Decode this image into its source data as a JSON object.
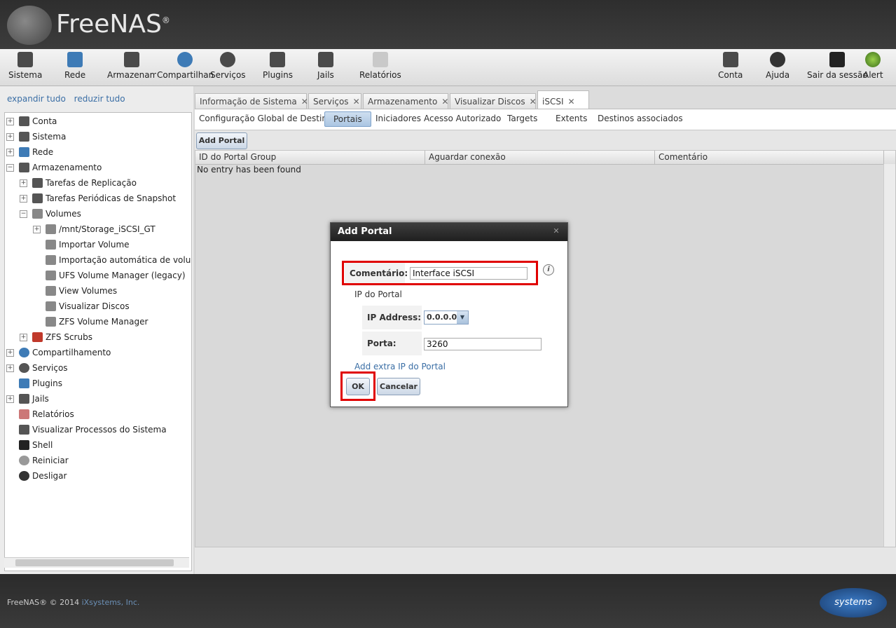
{
  "app": {
    "brand": "FreeNAS",
    "registered": "®"
  },
  "toolbar": {
    "sistema": "Sistema",
    "rede": "Rede",
    "armazenamento": "Armazenamento",
    "compartilhamento": "Compartilhamento",
    "servicos": "Serviços",
    "plugins": "Plugins",
    "jails": "Jails",
    "relatorios": "Relatórios",
    "conta": "Conta",
    "ajuda": "Ajuda",
    "sair": "Sair da sessão",
    "alert": "Alert"
  },
  "sidebar": {
    "expand_all": "expandir tudo",
    "collapse_all": "reduzir tudo",
    "tree": {
      "conta": "Conta",
      "sistema": "Sistema",
      "rede": "Rede",
      "armazenamento": "Armazenamento",
      "replicacao": "Tarefas de Replicação",
      "snapshot": "Tarefas Periódicas de Snapshot",
      "volumes": "Volumes",
      "mnt": "/mnt/Storage_iSCSI_GT",
      "importar": "Importar Volume",
      "auto_import": "Importação automática de volume",
      "ufs": "UFS Volume Manager (legacy)",
      "view_volumes": "View Volumes",
      "visualizar_discos": "Visualizar Discos",
      "zfs_manager": "ZFS Volume Manager",
      "zfs_scrubs": "ZFS Scrubs",
      "compartilhamento": "Compartilhamento",
      "servicos": "Serviços",
      "plugins": "Plugins",
      "jails": "Jails",
      "relatorios": "Relatórios",
      "processos": "Visualizar Processos do Sistema",
      "shell": "Shell",
      "reiniciar": "Reiniciar",
      "desligar": "Desligar"
    }
  },
  "tabs": {
    "info": "Informação de Sistema",
    "servicos": "Serviços",
    "armazenamento": "Armazenamento",
    "discos": "Visualizar Discos",
    "iscsi": "iSCSI",
    "close": "✕"
  },
  "subtabs": {
    "global": "Configuração Global de Destino",
    "portais": "Portais",
    "iniciadores": "Iniciadores",
    "acesso": "Acesso Autorizado",
    "targets": "Targets",
    "extents": "Extents",
    "destinos": "Destinos associados"
  },
  "portals": {
    "add_button": "Add Portal",
    "columns": [
      "ID do Portal Group",
      "Aguardar conexão",
      "Comentário"
    ],
    "empty": "No entry has been found"
  },
  "dialog": {
    "title": "Add Portal",
    "comment_label": "Comentário:",
    "comment_value": "Interface iSCSI",
    "ip_section": "IP do Portal",
    "ip_label": "IP Address:",
    "ip_value": "0.0.0.0",
    "port_label": "Porta:",
    "port_value": "3260",
    "add_extra": "Add extra IP do Portal",
    "ok": "OK",
    "cancel": "Cancelar"
  },
  "footer": {
    "copyright": "FreeNAS® © 2014 ",
    "company": "iXsystems, Inc.",
    "logo_text": "systems"
  },
  "colors": {
    "accent": "#3a6ea5",
    "highlight": "#e00000",
    "header": "#2e2e2e"
  }
}
